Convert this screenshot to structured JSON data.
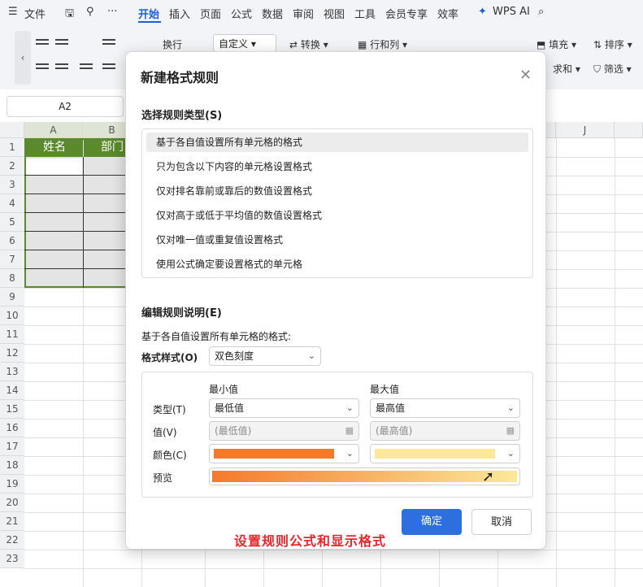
{
  "menubar": {
    "file": "文件",
    "tabs": [
      "开始",
      "插入",
      "页面",
      "公式",
      "数据",
      "审阅",
      "视图",
      "工具",
      "会员专享",
      "效率"
    ],
    "wps_ai": "WPS AI"
  },
  "ribbon": {
    "wrap": "换行",
    "number_format": "自定义",
    "convert": "转换",
    "rows_cols": "行和列",
    "fill": "填充",
    "sort": "排序",
    "sum": "求和",
    "filter": "筛选"
  },
  "namebox": "A2",
  "sheet": {
    "columns": [
      "A",
      "B",
      "J"
    ],
    "rows": [
      "1",
      "2",
      "3",
      "4",
      "5",
      "6",
      "7",
      "8",
      "9",
      "10",
      "11",
      "12",
      "13",
      "14",
      "15",
      "16",
      "17",
      "18",
      "19",
      "20",
      "21",
      "22",
      "23"
    ],
    "header_a": "姓名",
    "header_b": "部门"
  },
  "dialog": {
    "title": "新建格式规则",
    "rule_type_label": "选择规则类型(S)",
    "rules": [
      "基于各自值设置所有单元格的格式",
      "只为包含以下内容的单元格设置格式",
      "仅对排名靠前或靠后的数值设置格式",
      "仅对高于或低于平均值的数值设置格式",
      "仅对唯一值或重复值设置格式",
      "使用公式确定要设置格式的单元格"
    ],
    "edit_label": "编辑规则说明(E)",
    "desc": "基于各自值设置所有单元格的格式:",
    "format_style_label": "格式样式(O)",
    "format_style_value": "双色刻度",
    "min_header": "最小值",
    "max_header": "最大值",
    "type_label": "类型(T)",
    "value_label": "值(V)",
    "color_label": "颜色(C)",
    "preview_label": "预览",
    "min_type": "最低值",
    "max_type": "最高值",
    "min_value": "(最低值)",
    "max_value": "(最高值)",
    "min_color": "#f47a2a",
    "max_color": "#fbe999",
    "ok": "确定",
    "cancel": "取消"
  },
  "caption": "设置规则公式和显示格式"
}
